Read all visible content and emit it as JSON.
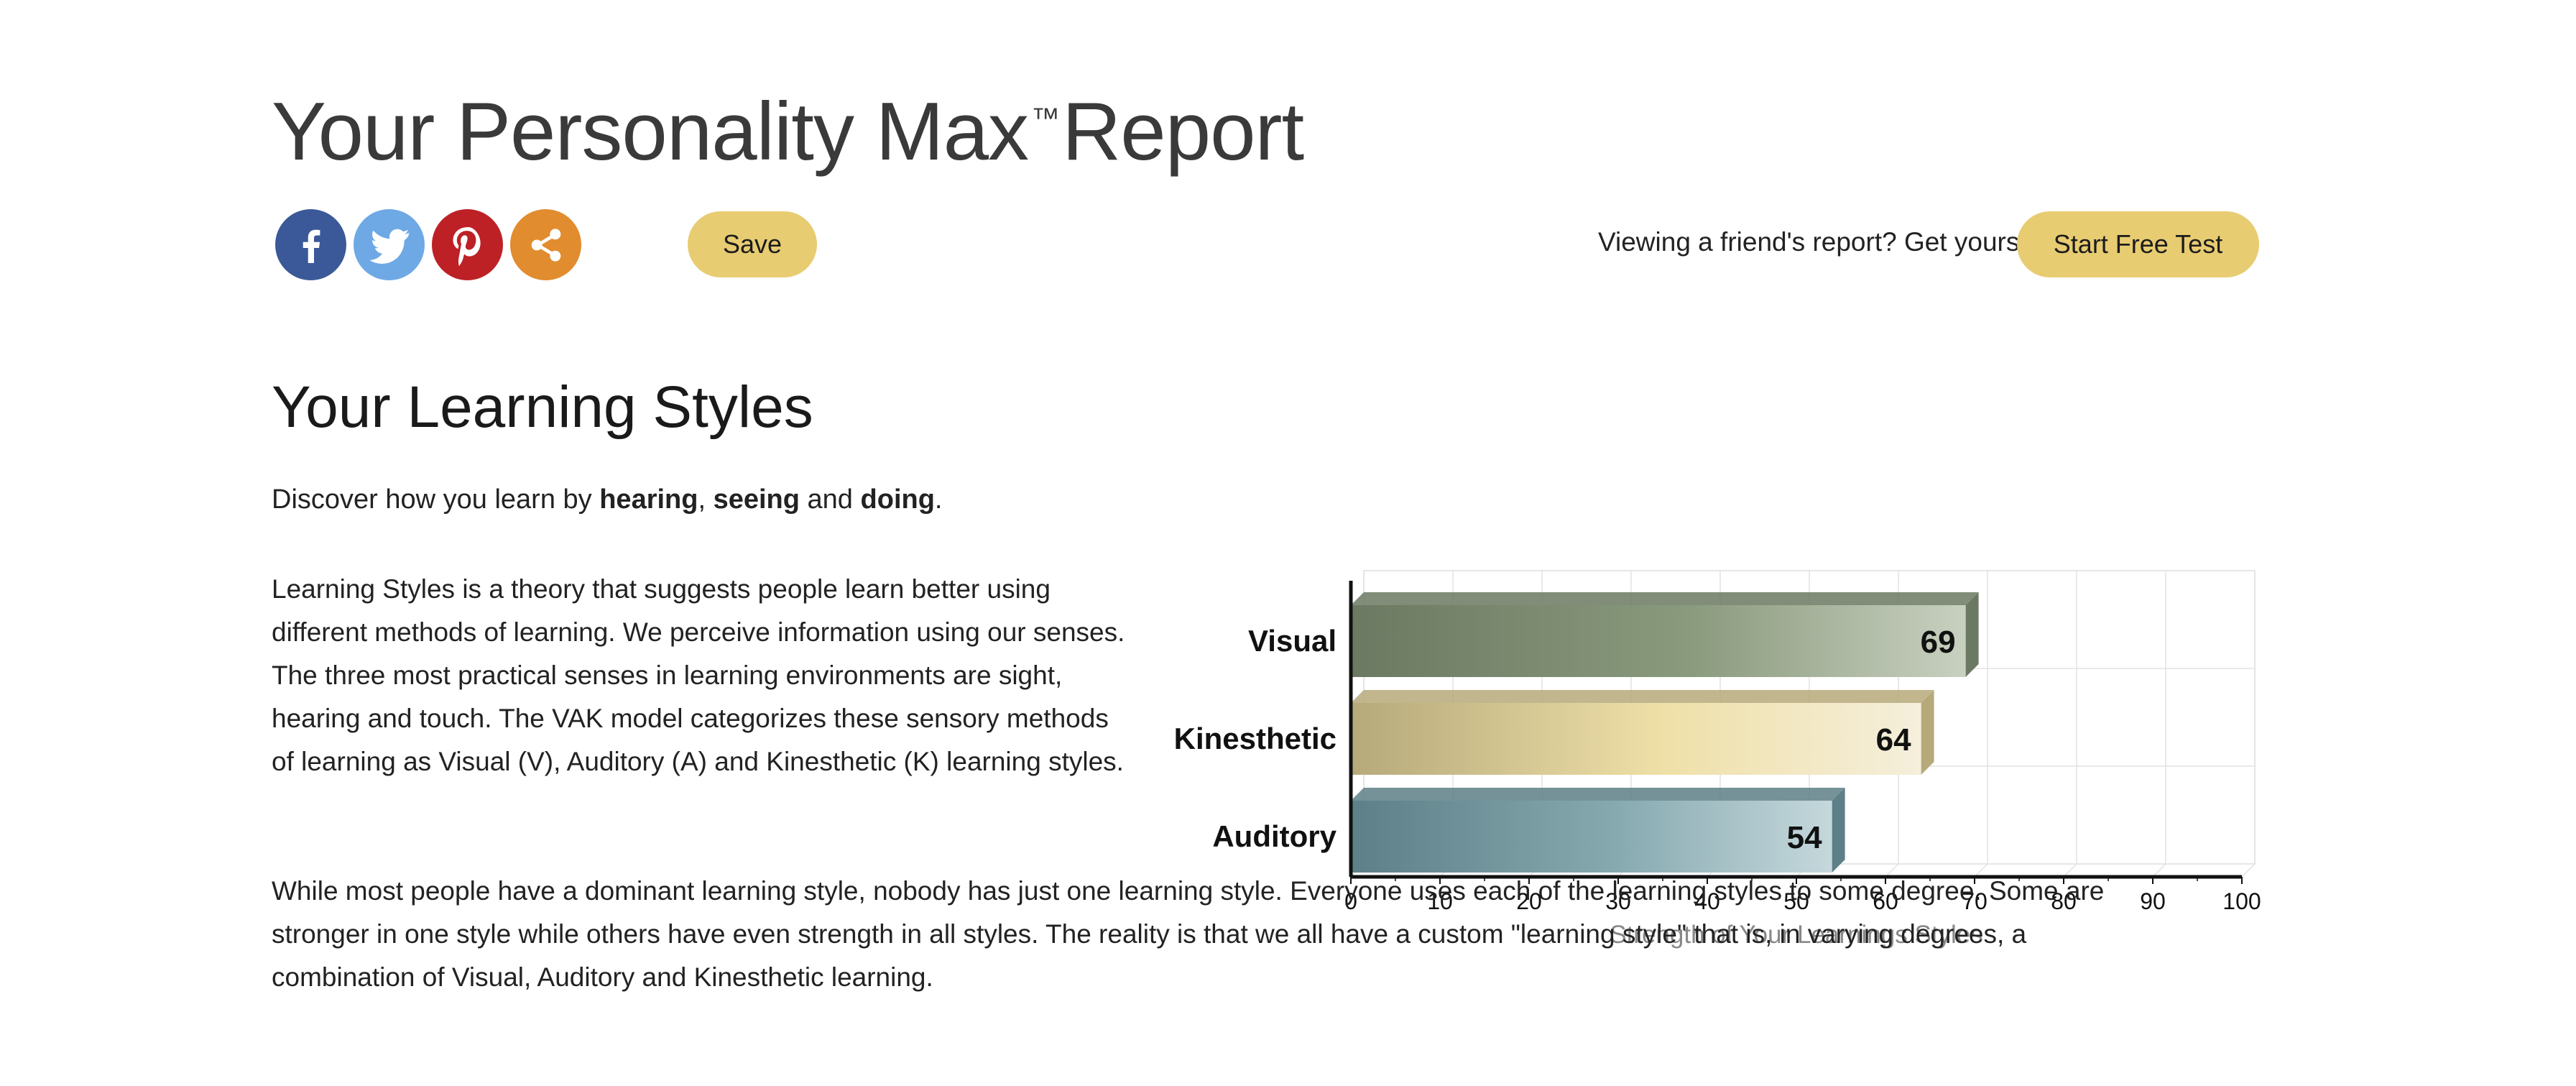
{
  "header": {
    "title_main": "Your Personality Max",
    "title_tm": "™",
    "title_end": "Report"
  },
  "social": [
    {
      "name": "facebook-icon",
      "color": "#3b5998"
    },
    {
      "name": "twitter-icon",
      "color": "#6ea9e6"
    },
    {
      "name": "pinterest-icon",
      "color": "#bd2126"
    },
    {
      "name": "share-icon",
      "color": "#e18c2e"
    }
  ],
  "toolbar": {
    "save_label": "Save",
    "friend_note": "Viewing a friend's report? Get yours!",
    "start_label": "Start Free Test",
    "button_color": "#e8cc72"
  },
  "section": {
    "title": "Your Learning Styles",
    "intro": {
      "prefix": "Discover how you learn by ",
      "hearing": "hearing",
      "comma": ", ",
      "seeing": "seeing",
      "and": " and ",
      "doing": "doing",
      "period": "."
    },
    "paragraph1": "Learning Styles is a theory that suggests people learn better using different methods of learning. We perceive information using our senses. The three most practical senses in learning environments are sight, hearing and touch. The VAK model categorizes these sensory methods of learning as Visual (V), Auditory (A) and Kinesthetic (K) learning styles.",
    "paragraph2": "While most people have a dominant learning style, nobody has just one learning style. Everyone uses each of the learning styles to some degree. Some are stronger in one style while others have even strength in all styles. The reality is that we all have a custom \"learning style\" that is, in varying degrees, a combination of Visual, Auditory and Kinesthetic learning."
  },
  "chart_data": {
    "type": "bar",
    "orientation": "horizontal",
    "categories": [
      "Visual",
      "Kinesthetic",
      "Auditory"
    ],
    "values": [
      69,
      64,
      54
    ],
    "colors": [
      [
        "#6b7962",
        "#8a9a7c",
        "#c8d0c0"
      ],
      [
        "#b6a97a",
        "#efe0a8",
        "#f5efdc"
      ],
      [
        "#5d7f87",
        "#86a9b0",
        "#c5d8dc"
      ]
    ],
    "xlabel": "Strength of Your Learnings Styles",
    "ylabel": "",
    "xlim": [
      0,
      100
    ],
    "xticks": [
      0,
      10,
      20,
      30,
      40,
      50,
      60,
      70,
      80,
      90,
      100
    ],
    "grid": true
  }
}
